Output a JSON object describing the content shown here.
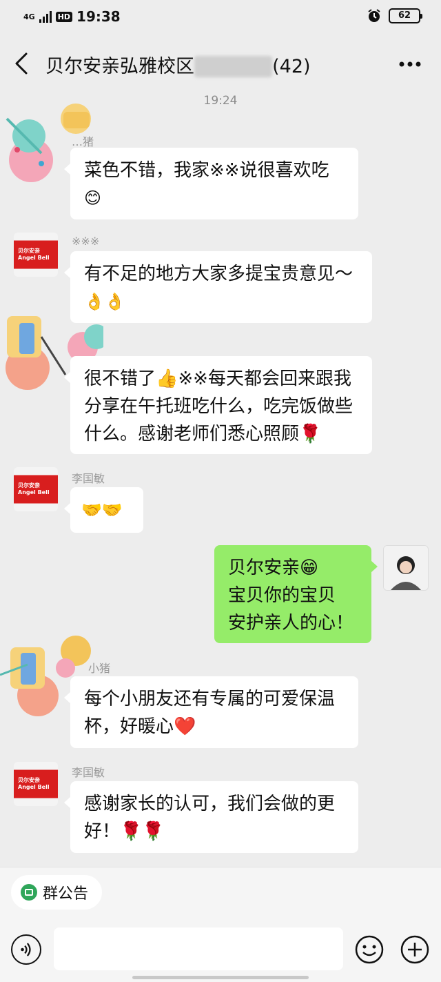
{
  "status_bar": {
    "network": "4G",
    "hd": "HD",
    "time": "19:38",
    "battery": "62"
  },
  "header": {
    "title_visible": "贝尔安亲弘雅校区",
    "title_blurred": "※※※※※",
    "member_count": "(42)",
    "back_icon": "back-chevron-icon",
    "more_icon": "more-dots-icon"
  },
  "chat": {
    "timestamp": "19:24",
    "messages": [
      {
        "side": "left",
        "avatar": "sticker",
        "name": "…猪",
        "text": "菜色不错，我家※※说很喜欢吃",
        "trail": "😊"
      },
      {
        "side": "left",
        "avatar": "brand",
        "name": "※※※",
        "text": "有不足的地方大家多提宝贵意见～",
        "trail": "👌👌"
      },
      {
        "side": "left",
        "avatar": "sticker",
        "name": "",
        "text": "很不错了👍※※每天都会回来跟我分享在午托班吃什么，吃完饭做些什么。感谢老师们悉心照顾🌹"
      },
      {
        "side": "left",
        "avatar": "brand",
        "name": "李国敏",
        "text": "🤝🤝"
      },
      {
        "side": "right",
        "avatar": "photo",
        "name": "",
        "lines": [
          "贝尔安亲😁",
          "宝贝你的宝贝",
          "安护亲人的心！"
        ]
      },
      {
        "side": "left",
        "avatar": "sticker",
        "name": "小猪",
        "text": "每个小朋友还有专属的可爱保温杯，好暖心❤️"
      },
      {
        "side": "left",
        "avatar": "brand",
        "name": "李国敏",
        "text": "感谢家长的认可，我们会做的更好！🌹🌹"
      }
    ],
    "brand_logo_cn": "贝尔安亲",
    "brand_logo_en": "Angel Bell"
  },
  "bottom": {
    "group_notice_label": "群公告",
    "input_value": "",
    "voice_icon": "voice-icon",
    "emoji_icon": "emoji-icon",
    "plus_icon": "plus-icon"
  }
}
